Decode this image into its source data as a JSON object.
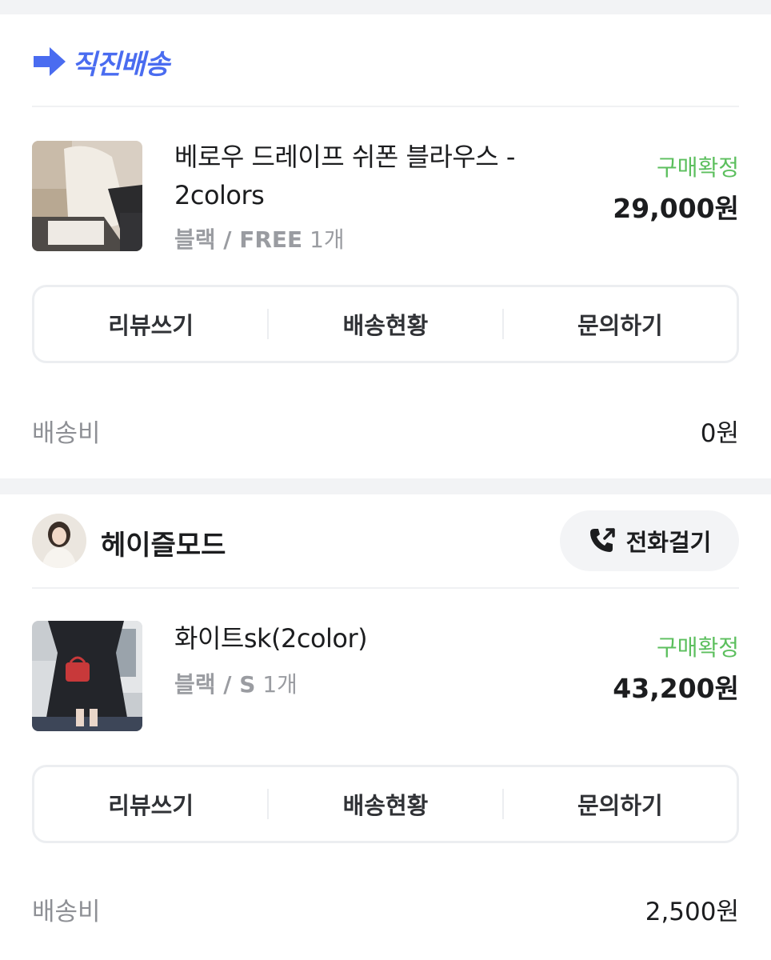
{
  "section": {
    "title": "직진배송",
    "icon": "arrow-right-icon",
    "accent_color": "#4a6cf0"
  },
  "orders": [
    {
      "product_name": "베로우 드레이프 쉬폰 블라우스 - 2colors",
      "option": "블랙 / FREE",
      "quantity": "1개",
      "status": "구매확정",
      "price": "29,000원",
      "actions": [
        "리뷰쓰기",
        "배송현황",
        "문의하기"
      ],
      "shipping_label": "배송비",
      "shipping_fee": "0원"
    },
    {
      "product_name": "화이트sk(2color)",
      "option": "블랙 / S",
      "quantity": "1개",
      "status": "구매확정",
      "price": "43,200원",
      "actions": [
        "리뷰쓰기",
        "배송현황",
        "문의하기"
      ],
      "shipping_label": "배송비",
      "shipping_fee": "2,500원"
    }
  ],
  "store": {
    "name": "헤이즐모드",
    "call_label": "전화걸기",
    "call_icon": "phone-call-icon"
  },
  "status_color": "#5cbf5e"
}
